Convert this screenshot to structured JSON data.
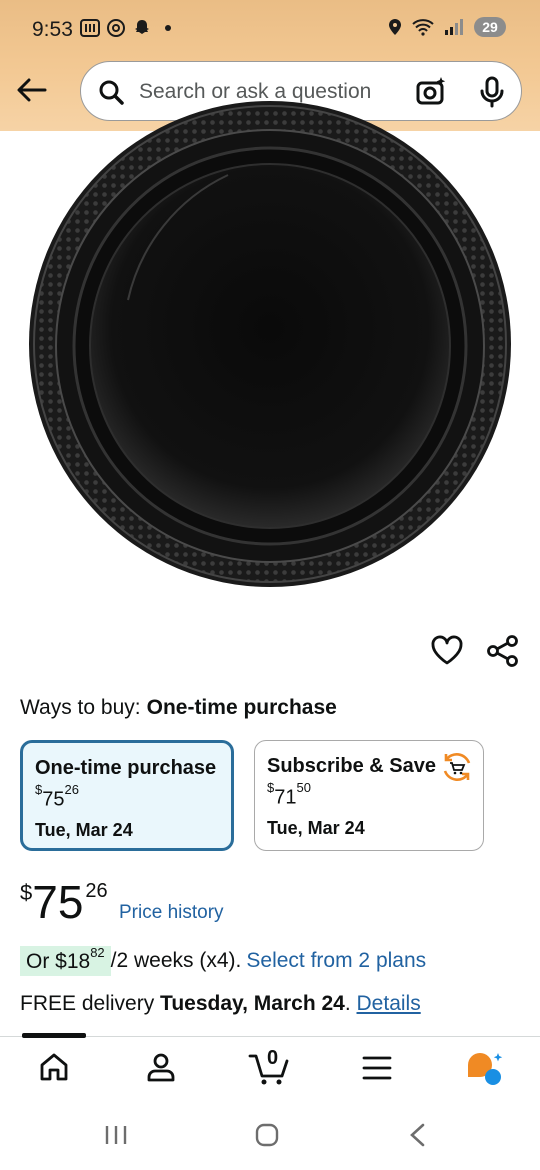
{
  "status": {
    "time": "9:53",
    "battery": "29"
  },
  "search": {
    "placeholder": "Search or ask a question"
  },
  "buy": {
    "ways_label": "Ways to buy:",
    "ways_value": "One-time purchase"
  },
  "options": [
    {
      "title": "One-time purchase",
      "price_symbol": "$",
      "price_dollars": "75",
      "price_cents": "26",
      "date": "Tue, Mar 24"
    },
    {
      "title": "Subscribe & Save",
      "price_symbol": "$",
      "price_dollars": "71",
      "price_cents": "50",
      "date": "Tue, Mar 24"
    }
  ],
  "price": {
    "symbol": "$",
    "dollars": "75",
    "cents": "26",
    "history_label": "Price history"
  },
  "installments": {
    "prefix": "Or $",
    "dollars": "18",
    "cents": "82",
    "period": "/2 weeks (x4).",
    "link": "Select from 2 plans"
  },
  "delivery": {
    "prefix": "FREE delivery ",
    "date": "Tuesday, March 24",
    "sep": ". ",
    "link": "Details"
  },
  "cart": {
    "count": "0"
  },
  "colors": {
    "header": "#f3c994",
    "selected_border": "#2a6d9a",
    "link": "#2162a1",
    "installment_bg": "#d8f3e3",
    "rufus_orange": "#f08a24",
    "rufus_blue": "#1a8fe3"
  },
  "icons": [
    "back-arrow-icon",
    "search-icon",
    "camera-icon",
    "mic-icon",
    "heart-icon",
    "share-icon",
    "subscribe-cart-icon",
    "home-icon",
    "person-icon",
    "cart-icon",
    "menu-icon",
    "rufus-icon"
  ]
}
